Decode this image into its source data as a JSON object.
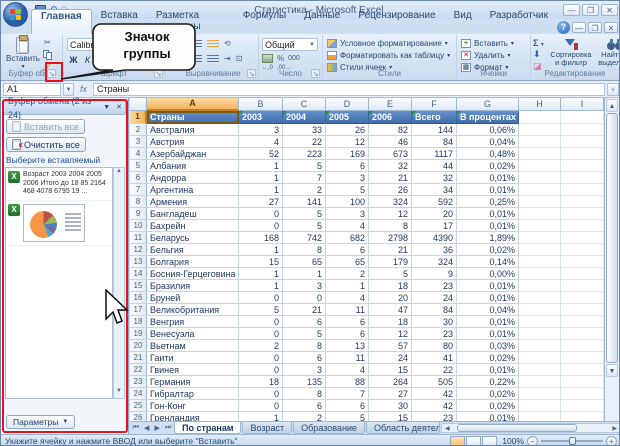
{
  "window": {
    "title": "Статистика - Microsoft Excel"
  },
  "tabs": [
    {
      "label": "Главная",
      "active": true
    },
    {
      "label": "Вставка",
      "active": false
    },
    {
      "label": "Разметка страницы",
      "active": false
    },
    {
      "label": "Формулы",
      "active": false
    },
    {
      "label": "Данные",
      "active": false
    },
    {
      "label": "Рецензирование",
      "active": false
    },
    {
      "label": "Вид",
      "active": false
    },
    {
      "label": "Разработчик",
      "active": false
    }
  ],
  "ribbon": {
    "clipboard": {
      "paste_label": "Вставить",
      "group_label": "Буфер обм..."
    },
    "font": {
      "font_name": "Calibri",
      "bold": "Ж",
      "italic": "К",
      "underline": "Ч",
      "group_label": "Шрифт"
    },
    "alignment": {
      "group_label": "Выравнивание"
    },
    "number": {
      "format": "Общий",
      "percent": "%",
      "thousands": "000",
      "group_label": "Число"
    },
    "styles": {
      "conditional": "Условное форматирование",
      "format_table": "Форматировать как таблицу",
      "cell_styles": "Стили ячеек",
      "group_label": "Стили"
    },
    "cells": {
      "insert": "Вставить",
      "delete": "Удалить",
      "format": "Формат",
      "group_label": "Ячейки"
    },
    "editing": {
      "sum": "Σ",
      "sort": "Сортировка и фильтр",
      "find": "Найти и выделить",
      "group_label": "Редактирование"
    }
  },
  "callout": {
    "line1": "Значок",
    "line2": "группы"
  },
  "formula_bar": {
    "name_box": "A1",
    "fx": "fx",
    "content": "Страны"
  },
  "clipboard_pane": {
    "title": "Буфер обмена (2 из 24)",
    "paste_all": "Вставить все",
    "clear_all": "Очистить все",
    "select_label": "Выберите вставляемый объект:",
    "items": [
      {
        "type": "text",
        "text": "Возраст 2003 2004 2005 2006 Итого до 18 85 2164 468 4078 6795 19 ..."
      },
      {
        "type": "chart",
        "icon": "excel-pie-chart-thumbnail"
      }
    ],
    "options_label": "Параметры"
  },
  "grid": {
    "column_letters": [
      "A",
      "B",
      "C",
      "D",
      "E",
      "F",
      "G",
      "H",
      "I"
    ],
    "selected_cell": "A1",
    "header_row": [
      "Страны",
      "2003",
      "2004",
      "2005",
      "2006",
      "Всего",
      "В процентах"
    ],
    "rows": [
      [
        "Австралия",
        "3",
        "33",
        "26",
        "82",
        "144",
        "0,06%"
      ],
      [
        "Австрия",
        "4",
        "22",
        "12",
        "46",
        "84",
        "0,04%"
      ],
      [
        "Азербайджан",
        "52",
        "223",
        "169",
        "673",
        "1117",
        "0,48%"
      ],
      [
        "Албания",
        "1",
        "5",
        "6",
        "32",
        "44",
        "0,02%"
      ],
      [
        "Андорра",
        "1",
        "7",
        "3",
        "21",
        "32",
        "0,01%"
      ],
      [
        "Аргентина",
        "1",
        "2",
        "5",
        "26",
        "34",
        "0,01%"
      ],
      [
        "Армения",
        "27",
        "141",
        "100",
        "324",
        "592",
        "0,25%"
      ],
      [
        "Бангладеш",
        "0",
        "5",
        "3",
        "12",
        "20",
        "0,01%"
      ],
      [
        "Бахрейн",
        "0",
        "5",
        "4",
        "8",
        "17",
        "0,01%"
      ],
      [
        "Беларусь",
        "168",
        "742",
        "682",
        "2798",
        "4390",
        "1,89%"
      ],
      [
        "Бельгия",
        "1",
        "8",
        "6",
        "21",
        "36",
        "0,02%"
      ],
      [
        "Болгария",
        "15",
        "65",
        "65",
        "179",
        "324",
        "0,14%"
      ],
      [
        "Босния-Герцеговина",
        "1",
        "1",
        "2",
        "5",
        "9",
        "0,00%"
      ],
      [
        "Бразилия",
        "1",
        "3",
        "1",
        "18",
        "23",
        "0,01%"
      ],
      [
        "Бруней",
        "0",
        "0",
        "4",
        "20",
        "24",
        "0,01%"
      ],
      [
        "Великобритания",
        "5",
        "21",
        "11",
        "47",
        "84",
        "0,04%"
      ],
      [
        "Венгрия",
        "0",
        "6",
        "6",
        "18",
        "30",
        "0,01%"
      ],
      [
        "Венесуэла",
        "0",
        "5",
        "6",
        "12",
        "23",
        "0,01%"
      ],
      [
        "Вьетнам",
        "2",
        "8",
        "13",
        "57",
        "80",
        "0,03%"
      ],
      [
        "Гаити",
        "0",
        "6",
        "11",
        "24",
        "41",
        "0,02%"
      ],
      [
        "Гвинея",
        "0",
        "3",
        "4",
        "15",
        "22",
        "0,01%"
      ],
      [
        "Германия",
        "18",
        "135",
        "88",
        "264",
        "505",
        "0,22%"
      ],
      [
        "Гибралтар",
        "0",
        "8",
        "7",
        "27",
        "42",
        "0,02%"
      ],
      [
        "Гон-Конг",
        "0",
        "6",
        "6",
        "30",
        "42",
        "0,02%"
      ],
      [
        "Гренландия",
        "1",
        "2",
        "5",
        "15",
        "23",
        "0,01%"
      ]
    ]
  },
  "sheet_bar": {
    "tabs": [
      {
        "label": "По странам",
        "active": true
      },
      {
        "label": "Возраст",
        "active": false
      },
      {
        "label": "Образование",
        "active": false
      },
      {
        "label": "Область деятельн",
        "active": false
      }
    ]
  },
  "status_bar": {
    "message": "Укажите ячейку и нажмите ВВОД или выберите \"Вставить\"",
    "zoom_level": "100%"
  }
}
